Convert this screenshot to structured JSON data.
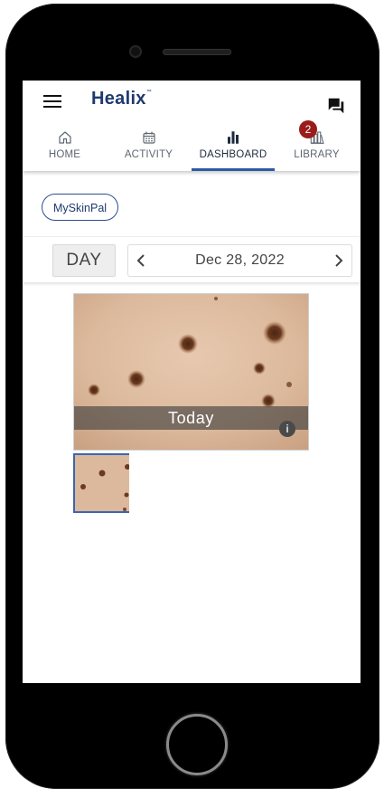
{
  "app": {
    "logo_text": "Healix",
    "logo_mark": "™"
  },
  "tabs": [
    {
      "label": "HOME",
      "icon": "home-icon",
      "active": false
    },
    {
      "label": "ACTIVITY",
      "icon": "calendar-icon",
      "active": false
    },
    {
      "label": "DASHBOARD",
      "icon": "bar-chart-icon",
      "active": true
    },
    {
      "label": "LIBRARY",
      "icon": "books-icon",
      "active": false
    }
  ],
  "library_badge": "2",
  "filter_chip": "MySkinPal",
  "period": {
    "label": "DAY",
    "date": "Dec 28, 2022"
  },
  "photo": {
    "caption": "Today",
    "info_label": "i"
  },
  "colors": {
    "accent": "#2b5aa8",
    "brand": "#1e3a6e",
    "badge": "#9b1b1b"
  }
}
